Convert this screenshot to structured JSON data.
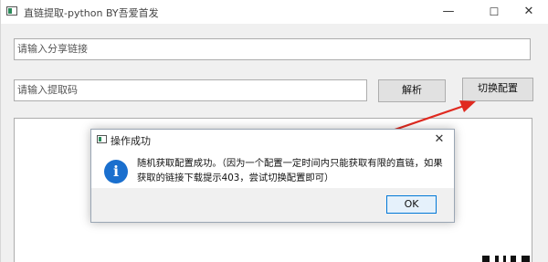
{
  "window": {
    "title": "直链提取-python BY吾爱首发",
    "minimize_glyph": "—",
    "maximize_glyph": "☐",
    "close_glyph": "✕"
  },
  "form": {
    "share_link_placeholder": "请输入分享链接",
    "extract_code_placeholder": "请输入提取码",
    "parse_label": "解析",
    "switch_config_label": "切换配置"
  },
  "dialog": {
    "title": "操作成功",
    "close_glyph": "✕",
    "info_glyph": "i",
    "message": "随机获取配置成功。（因为一个配置一定时间内只能获取有限的直链，如果获取的链接下载提示403，尝试切换配置即可）",
    "ok_label": "OK"
  },
  "colors": {
    "arrow": "#e02a20",
    "info_icon": "#1a6fce",
    "ok_border": "#0078d7"
  },
  "icons": {
    "app": "app-window-icon",
    "info": "info-icon"
  }
}
